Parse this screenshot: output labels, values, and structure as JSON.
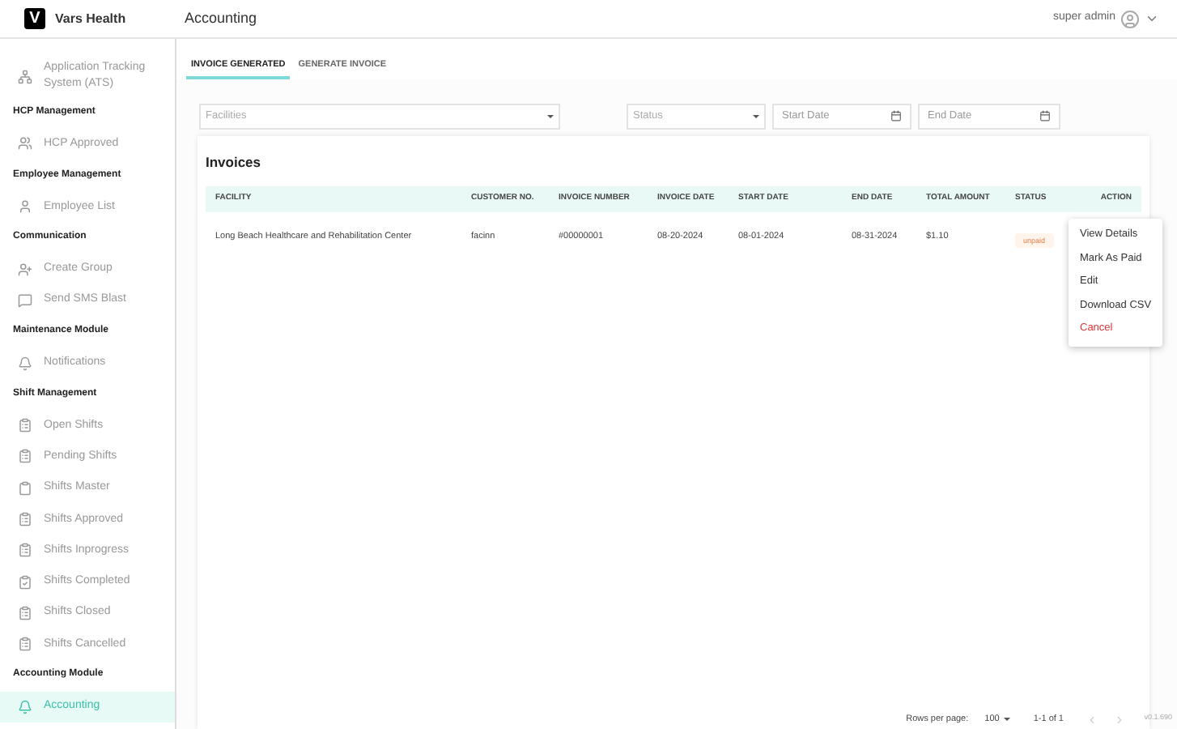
{
  "brand": {
    "logo": "V",
    "name": "Vars Health"
  },
  "header": {
    "title": "Accounting",
    "user": "super admin"
  },
  "sidebar": {
    "sections": [
      {
        "items": [
          {
            "label": "Application Tracking System (ATS)",
            "selected": false
          }
        ]
      },
      {
        "title": "HCP Management",
        "items": [
          {
            "label": "HCP Approved",
            "selected": false
          }
        ]
      },
      {
        "title": "Employee Management",
        "items": [
          {
            "label": "Employee List",
            "selected": false
          }
        ]
      },
      {
        "title": "Communication",
        "items": [
          {
            "label": "Create Group",
            "selected": false
          },
          {
            "label": "Send SMS Blast",
            "selected": false
          }
        ]
      },
      {
        "title": "Maintenance Module",
        "items": [
          {
            "label": "Notifications",
            "selected": false
          }
        ]
      },
      {
        "title": "Shift Management",
        "items": [
          {
            "label": "Open Shifts",
            "selected": false
          },
          {
            "label": "Pending Shifts",
            "selected": false
          },
          {
            "label": "Shifts Master",
            "selected": false
          },
          {
            "label": "Shifts Approved",
            "selected": false
          },
          {
            "label": "Shifts Inprogress",
            "selected": false
          },
          {
            "label": "Shifts Completed",
            "selected": false
          },
          {
            "label": "Shifts Closed",
            "selected": false
          },
          {
            "label": "Shifts Cancelled",
            "selected": false
          }
        ]
      },
      {
        "title": "Accounting Module",
        "items": [
          {
            "label": "Accounting",
            "selected": true
          }
        ]
      }
    ]
  },
  "tabs": [
    {
      "label": "INVOICE GENERATED",
      "selected": true
    },
    {
      "label": "GENERATE INVOICE",
      "selected": false
    }
  ],
  "filters": {
    "facilities": {
      "placeholder": "Facilities"
    },
    "status": {
      "placeholder": "Status"
    },
    "start_date": {
      "placeholder": "Start Date"
    },
    "end_date": {
      "placeholder": "End Date"
    }
  },
  "table": {
    "title": "Invoices",
    "columns": [
      "FACILITY",
      "CUSTOMER NO.",
      "INVOICE NUMBER",
      "INVOICE DATE",
      "START DATE",
      "END DATE",
      "TOTAL AMOUNT",
      "STATUS",
      "ACTION"
    ],
    "rows": [
      {
        "cells": [
          "Long Beach Healthcare and Rehabilitation Center",
          "facinn",
          "#00000001",
          "08-20-2024",
          "08-01-2024",
          "08-31-2024",
          "$1.10"
        ],
        "status": "unpaid"
      }
    ]
  },
  "action_menu": [
    {
      "label": "View Details",
      "kind": "normal"
    },
    {
      "label": "Mark As Paid",
      "kind": "normal"
    },
    {
      "label": "Edit",
      "kind": "normal"
    },
    {
      "label": "Download CSV",
      "kind": "normal"
    },
    {
      "label": "Cancel",
      "kind": "danger"
    }
  ],
  "pagination": {
    "rows_per_page_label": "Rows per page:",
    "rows_per_page": "100",
    "range": "1-1 of 1",
    "prev_disabled": true,
    "next_disabled": true
  },
  "version": "v0.1.690"
}
